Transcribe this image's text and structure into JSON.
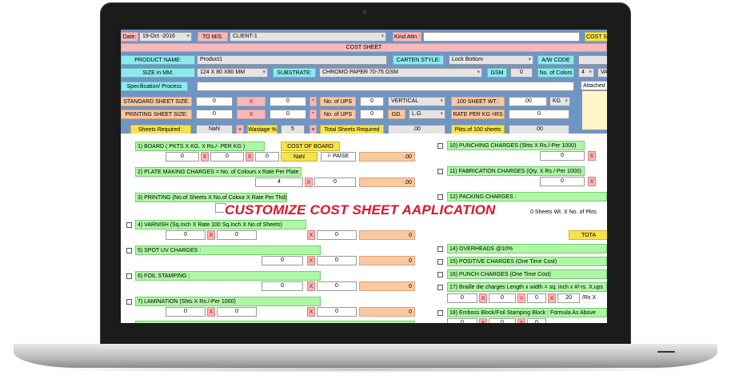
{
  "top": {
    "date_label": "Date:",
    "date_value": "19-Oct -2016",
    "to_label": "TO M/S.",
    "client_value": "CLIENT-1",
    "kind_label": "Kind Attn :",
    "kind_value": "",
    "cost_btn": "COST S"
  },
  "title": "COST SHEET",
  "row1": {
    "product_label": "PRODUCT NAME:",
    "product_value": "Product1",
    "carten_label": "CARTEN STYLE:",
    "carten_value": "Lock Bottom",
    "aw_label": "A/W CODE",
    "aw_value": ""
  },
  "row2": {
    "size_label": "SIZE in MM:",
    "size_value": "124 X 80 X80 MM",
    "substrate_label": "SUBSTRATE:",
    "substrate_value": "CHROMO PAPER 70-75 GSM",
    "gsm_label": "GSM",
    "gsm_value": "0",
    "colors_label": "No. of Colors",
    "colors_value": "4",
    "va_value": "VA"
  },
  "row3": {
    "spec_label": "Specification/ Process",
    "attached_label": "Attached"
  },
  "row4": {
    "std_label": "STANDARD SHEET SIZE:",
    "std_a": "0",
    "std_quote": "\"",
    "std_x": "X",
    "std_b": "0",
    "std_quote2": "\"",
    "ups_label": "No. of UPS",
    "ups_value": "0",
    "orient_value": "VERTICAL",
    "wt_label": "100 SHEET WT.:",
    "wt_value": ".00",
    "unit_value": "KG"
  },
  "row5": {
    "print_label": "PRINTING SHEET SIZE:",
    "print_a": "0",
    "print_quote": "\"",
    "print_x": "X",
    "print_b": "0",
    "print_quote2": "\"",
    "ups_label": "No. of UPS",
    "ups_value": "0",
    "gd_label": "GD.",
    "gd_value": "L.G.",
    "rate_label": "RATE PER KG =RS",
    "rate_value": "0"
  },
  "row6": {
    "req_label": "Sheets Required :",
    "req_value": "NaN",
    "plus": "+",
    "wastage_label": "Wastage %",
    "wastage_value": "5",
    "eq": "=",
    "total_label": "Total Sheets Required",
    "total_value": ".00",
    "pkts_label": "Pkts.of 100 sheets",
    "pkts_value": ".00"
  },
  "left": {
    "s1_label": "1) BOARD  ( PKTS  X KG. X  Rs./- PER KG )",
    "s1_a": "0",
    "s1_b": "0",
    "s1_c": "0",
    "cost_board_label": "COST OF BOARD",
    "cost_board_value": "NaN",
    "paise_label": "/- PAISE",
    "s1_total": ".00",
    "s2_label": "2) PLATE MAKING CHARGES = No. of Colours x Rate Per Plate",
    "s2_a": "4",
    "s2_b": "0",
    "s2_total": ".00",
    "s3_label": "3) PRINTING (No.of Sheets X No.of Colour X Rate Per Thd)",
    "s4_label": "4) VARNISH (Sq.Inch X Rate 100 Sq.Inch X No.of Sheets)",
    "s4_a": "0",
    "s4_b": "0",
    "s4_c": "0",
    "s4_total": "0",
    "s5_label": "5) SPOT UV CHARGES :",
    "s5_a": "0",
    "s5_b": "0",
    "s5_total": "0",
    "s6_label": "6) FOIL STAMPING :",
    "s6_a": "0",
    "s6_b": "0",
    "s6_total": "0",
    "s7_label": "7) LAMINATION (Shts X Rs./-Per 1000)",
    "s7_a": "0",
    "s7_b": "0",
    "s7_c": "0",
    "s7_total": "0"
  },
  "right": {
    "s10_label": "10) PUNCHING CHARGES (Shts X Rs./-Per 1000)",
    "s10_a": "0",
    "s11_label": "11) FABRICATION CHARGES  (Qty. X Rs./-Per 1000)",
    "s11_a": "0",
    "s12_label": "12) PACKING CHARGES :",
    "s12_sub": "0 Sheets Wt.  X  No. of Pkts",
    "s12_total": "TOTA",
    "s14_label": "14) OVERHEADS @10%",
    "s15_label": "15) POSITIVE CHARGES (One Time Cost)",
    "s16_label": "16) PUNCH CHARGES (One Time Cost)",
    "s17_label": "17) Braille die charges Length x width = sq. inch x  #/-rs. X.ups",
    "s17_a": "0",
    "s17_b": "0",
    "s17_eq": "=",
    "s17_c": "0",
    "s17_d": "20",
    "s17_e": "/Rs X",
    "s18_label": "18) Emboss Block/Foil Stamping Block : Formula As Above",
    "s18_a": "0",
    "s18_b": "0",
    "s18_c": "0"
  },
  "overlay": "CUSTOMIZE COST SHEET AAPLICATION",
  "x_mark": "X"
}
